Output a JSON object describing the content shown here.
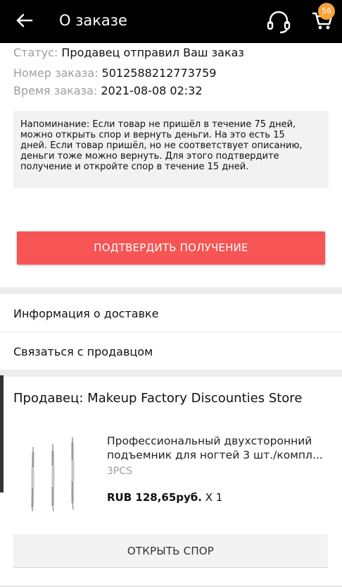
{
  "header": {
    "title": "О заказе",
    "cart_count": "56"
  },
  "order": {
    "status_label": "Статус:",
    "status_value": "Продавец отправил Ваш заказ",
    "number_label": "Номер заказа:",
    "number_value": "5012588212773759",
    "time_label": "Время заказа:",
    "time_value": "2021-08-08 02:32"
  },
  "reminder": {
    "text": "Напоминание: Если товар не пришёл в течение 75 дней,\nможно открыть спор и вернуть деньги. На это есть 15\nдней.    Если товар пришёл, но не соответствует описанию,\nденьги тоже можно вернуть. Для этого подтвердите\nполучение и откройте спор в течение 15 дней."
  },
  "actions": {
    "confirm_label": "ПОДТВЕРДИТЬ ПОЛУЧЕНИЕ",
    "delivery_info_label": "Информация о доставке",
    "contact_seller_label": "Связаться с продавцом",
    "open_dispute_label": "ОТКРЫТЬ СПОР"
  },
  "seller": {
    "title": "Продавец: Makeup Factory Discounties Store"
  },
  "product": {
    "name_line1": "Профессиональный двухсторонний",
    "name_line2": "подъемник для ногтей 3 шт./компл...",
    "variant": "3PCS",
    "price": "RUB 128,65руб.",
    "quantity": "X 1"
  },
  "colors": {
    "accent": "#f75454",
    "badge": "#f8a23a",
    "topbar": "#000000"
  },
  "icons": [
    "back-arrow-icon",
    "support-headset-icon",
    "cart-icon"
  ]
}
